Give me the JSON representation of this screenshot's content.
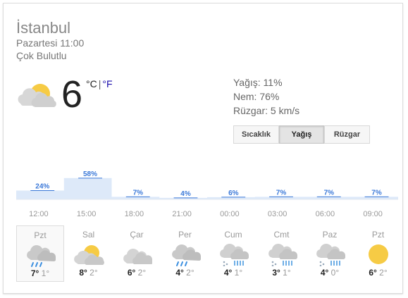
{
  "location": {
    "city": "İstanbul",
    "datetime": "Pazartesi 11:00",
    "condition": "Çok Bulutlu"
  },
  "current": {
    "temp": "6",
    "unit_c": "°C",
    "unit_sep": "|",
    "unit_f": "°F",
    "icon": "partly-cloudy-icon"
  },
  "details": {
    "precip": "Yağış: 11%",
    "humidity": "Nem: 76%",
    "wind": "Rüzgar: 5 km/s"
  },
  "tabs": [
    {
      "label": "Sıcaklık"
    },
    {
      "label": "Yağış",
      "active": true
    },
    {
      "label": "Rüzgar"
    }
  ],
  "chart_data": {
    "type": "area",
    "title": "",
    "xlabel": "",
    "ylabel": "",
    "x": [
      "12:00",
      "15:00",
      "18:00",
      "21:00",
      "00:00",
      "03:00",
      "06:00",
      "09:00"
    ],
    "values": [
      24,
      58,
      7,
      4,
      6,
      7,
      7,
      7
    ],
    "labels": [
      "24%",
      "58%",
      "7%",
      "4%",
      "6%",
      "7%",
      "7%",
      "7%"
    ],
    "ylim": [
      0,
      100
    ],
    "color": "#dde9f9",
    "line_color": "#3a78d8",
    "label_color": "#3a78d8"
  },
  "forecast": [
    {
      "day": "Pzt",
      "hi": "7°",
      "lo": "1°",
      "icon": "rain-cloud-icon",
      "selected": true
    },
    {
      "day": "Sal",
      "hi": "8°",
      "lo": "2°",
      "icon": "partly-cloudy-icon"
    },
    {
      "day": "Çar",
      "hi": "6°",
      "lo": "2°",
      "icon": "cloud-icon"
    },
    {
      "day": "Per",
      "hi": "4°",
      "lo": "2°",
      "icon": "rain-cloud-icon"
    },
    {
      "day": "Cum",
      "hi": "4°",
      "lo": "1°",
      "icon": "sleet-cloud-icon"
    },
    {
      "day": "Cmt",
      "hi": "3°",
      "lo": "1°",
      "icon": "sleet-cloud-icon"
    },
    {
      "day": "Paz",
      "hi": "4°",
      "lo": "0°",
      "icon": "sleet-cloud-icon"
    },
    {
      "day": "Pzt",
      "hi": "6°",
      "lo": "2°",
      "icon": "sun-icon"
    }
  ]
}
